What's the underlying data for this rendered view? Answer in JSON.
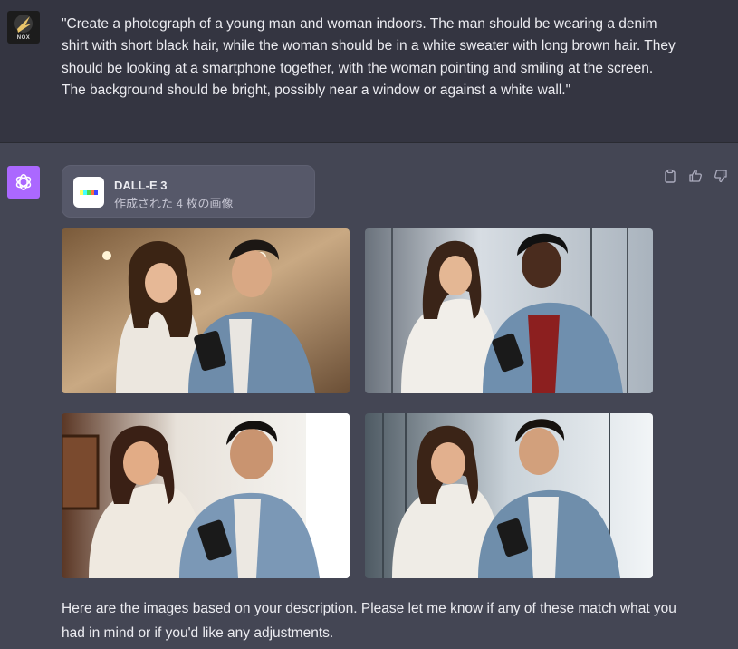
{
  "user_message": {
    "avatar_label": "NOX",
    "text": "\"Create a photograph of a young man and woman indoors. The man should be wearing a denim shirt with short black hair, while the woman should be in a white sweater with long brown hair. They should be looking at a smartphone together, with the woman pointing and smiling at the screen. The background should be bright, possibly near a window or against a white wall.\""
  },
  "assistant_message": {
    "avatar_icon": "openai-logo-icon",
    "tool": {
      "name": "DALL-E 3",
      "subtitle": "作成された 4 枚の画像",
      "logo_colors": [
        "#ffff66",
        "#42ffff",
        "#51da4c",
        "#ff6e3c",
        "#3c46ff"
      ]
    },
    "actions": [
      "clipboard-icon",
      "thumbs-up-icon",
      "thumbs-down-icon"
    ],
    "images": [
      {
        "name": "generated-image-1"
      },
      {
        "name": "generated-image-2"
      },
      {
        "name": "generated-image-3"
      },
      {
        "name": "generated-image-4"
      }
    ],
    "reply": "Here are the images based on your description. Please let me know if any of these match what you had in mind or if you'd like any adjustments."
  },
  "colors": {
    "user_bg": "#343541",
    "assistant_bg": "#444654",
    "bot_avatar": "#ab68ff",
    "text": "#ececf1"
  }
}
